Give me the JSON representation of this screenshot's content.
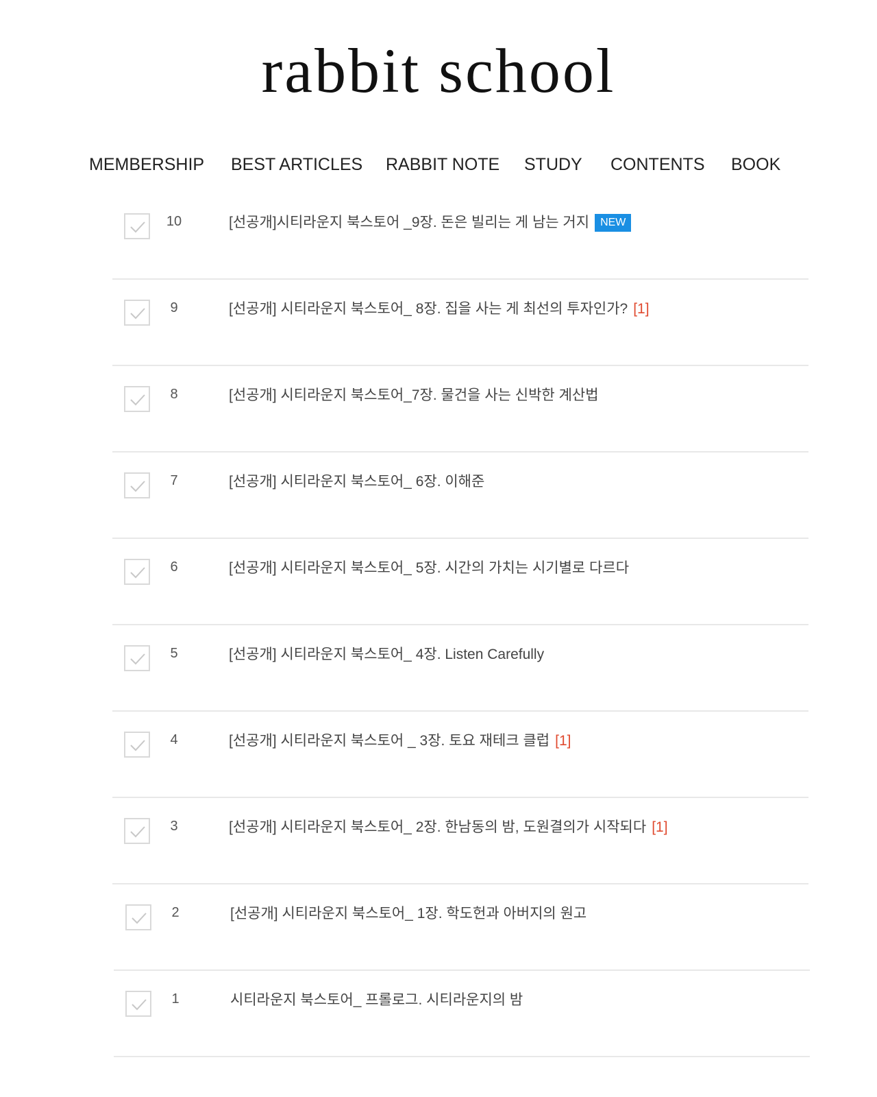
{
  "site": {
    "logo_text": "rabbit school"
  },
  "nav": {
    "items": [
      {
        "label": "MEMBERSHIP"
      },
      {
        "label": "BEST ARTICLES"
      },
      {
        "label": "RABBIT NOTE"
      },
      {
        "label": "STUDY"
      },
      {
        "label": "CONTENTS"
      },
      {
        "label": "BOOK"
      }
    ]
  },
  "colors": {
    "new_badge_bg": "#1a8fe3",
    "comment_count": "#e04a2f",
    "divider": "#e8e8e8",
    "check_icon": "#c8c8c8"
  },
  "posts": [
    {
      "number": "10",
      "title": "[선공개]시티라운지 북스토어 _9장. 돈은 빌리는 게 남는 거지",
      "badge": "NEW",
      "comments": ""
    },
    {
      "number": "9",
      "title": "[선공개] 시티라운지 북스토어_ 8장. 집을 사는 게 최선의 투자인가?",
      "badge": "",
      "comments": "[1]"
    },
    {
      "number": "8",
      "title": "[선공개] 시티라운지 북스토어_7장. 물건을 사는 신박한 계산법",
      "badge": "",
      "comments": ""
    },
    {
      "number": "7",
      "title": "[선공개] 시티라운지 북스토어_ 6장. 이해준",
      "badge": "",
      "comments": ""
    },
    {
      "number": "6",
      "title": "[선공개] 시티라운지 북스토어_ 5장. 시간의 가치는 시기별로 다르다",
      "badge": "",
      "comments": ""
    },
    {
      "number": "5",
      "title": "[선공개] 시티라운지 북스토어_ 4장. Listen Carefully",
      "badge": "",
      "comments": ""
    },
    {
      "number": "4",
      "title": "[선공개] 시티라운지 북스토어 _ 3장. 토요 재테크 클럽",
      "badge": "",
      "comments": "[1]"
    },
    {
      "number": "3",
      "title": "[선공개] 시티라운지 북스토어_ 2장. 한남동의 밤, 도원결의가 시작되다",
      "badge": "",
      "comments": "[1]"
    },
    {
      "number": "2",
      "title": "[선공개] 시티라운지 북스토어_ 1장. 학도헌과 아버지의 원고",
      "badge": "",
      "comments": ""
    },
    {
      "number": "1",
      "title": "시티라운지 북스토어_ 프롤로그. 시티라운지의 밤",
      "badge": "",
      "comments": ""
    }
  ]
}
